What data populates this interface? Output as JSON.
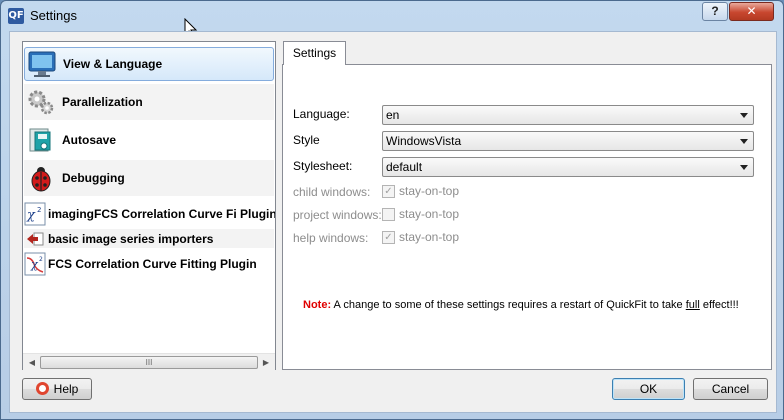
{
  "window": {
    "title": "Settings",
    "app_icon_text": "QF"
  },
  "titlebar": {
    "help_label": "?",
    "close_label": "✕"
  },
  "plugin_list": {
    "items": [
      {
        "label": "View & Language",
        "icon": "monitor-icon",
        "selected": true
      },
      {
        "label": "Parallelization",
        "icon": "gears-icon"
      },
      {
        "label": "Autosave",
        "icon": "save-document-icon"
      },
      {
        "label": "Debugging",
        "icon": "ladybug-icon"
      },
      {
        "label": "imagingFCS Correlation Curve Fi Plugin",
        "icon": "chi-squared-icon"
      },
      {
        "label": "basic image series importers",
        "icon": "import-arrow-icon"
      },
      {
        "label": "FCS Correlation Curve Fitting Plugin",
        "icon": "chi-squared-curve-icon"
      }
    ],
    "scroll_thumb": "III",
    "scroll_left": "◀",
    "scroll_right": "▶"
  },
  "tab": {
    "label": "Settings"
  },
  "settings": {
    "language_label": "Language:",
    "language_value": "en",
    "style_label": "Style",
    "style_value": "WindowsVista",
    "stylesheet_label": "Stylesheet:",
    "stylesheet_value": "default",
    "child_windows_label": "child windows:",
    "child_windows_option": "stay-on-top",
    "child_windows_checked": true,
    "project_windows_label": "project windows:",
    "project_windows_option": "stay-on-top",
    "project_windows_checked": false,
    "help_windows_label": "help windows:",
    "help_windows_option": "stay-on-top",
    "help_windows_checked": true
  },
  "note": {
    "prefix": "Note:",
    "text_before": " A change to some of these settings requires a restart of QuickFit to take ",
    "underlined": "full",
    "text_after": " effect!!!"
  },
  "buttons": {
    "help": "Help",
    "ok": "OK",
    "cancel": "Cancel"
  },
  "colors": {
    "note_red": "#e00000",
    "selection_border": "#84acdd",
    "close_red": "#c8472f"
  }
}
